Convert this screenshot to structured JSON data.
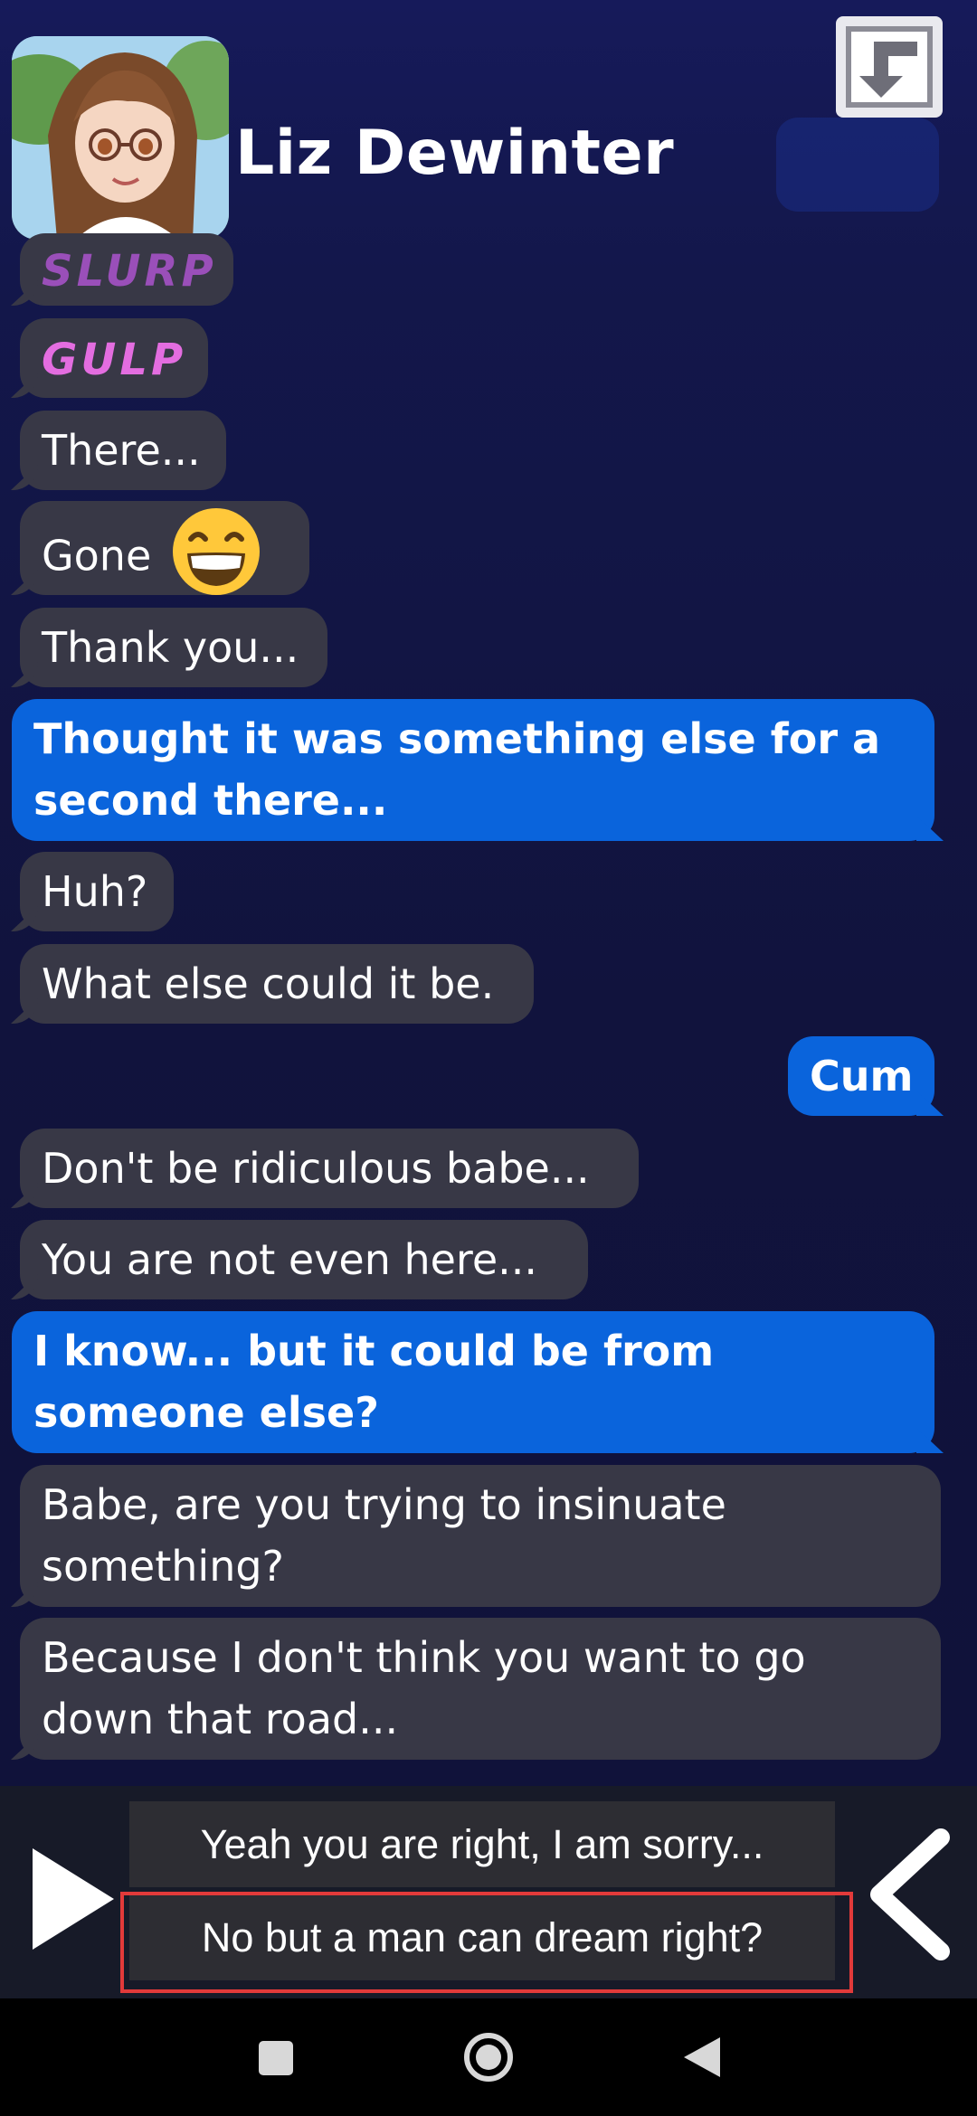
{
  "header": {
    "contact_name": "Liz Dewinter",
    "avatar_icon": "avatar-anime-girl-glasses",
    "download_icon": "download-arrow-icon"
  },
  "messages": [
    {
      "side": "in",
      "text": "SLURP",
      "style": "sfx"
    },
    {
      "side": "in",
      "text": "GULP",
      "style": "sfx"
    },
    {
      "side": "in",
      "text": "There..."
    },
    {
      "side": "in",
      "text": "Gone",
      "emoji": "grinning-face-emoji"
    },
    {
      "side": "in",
      "text": "Thank you..."
    },
    {
      "side": "out",
      "text": "Thought it was something else for a second there..."
    },
    {
      "side": "in",
      "text": "Huh?"
    },
    {
      "side": "in",
      "text": "What else could it be."
    },
    {
      "side": "out",
      "text": "Cum"
    },
    {
      "side": "in",
      "text": "Don't be ridiculous babe..."
    },
    {
      "side": "in",
      "text": "You are not even here..."
    },
    {
      "side": "out",
      "text": "I know... but it could be from someone else?"
    },
    {
      "side": "in",
      "text": "Babe, are you trying to insinuate something?"
    },
    {
      "side": "in",
      "text": "Because I don't think you want to go down that road..."
    }
  ],
  "choices": [
    {
      "label": "Yeah you are right, I am sorry...",
      "selected": false
    },
    {
      "label": "No but a man can dream right?",
      "selected": true
    }
  ],
  "controls": {
    "play_icon": "play-icon",
    "back_icon": "chevron-left-icon"
  },
  "navbar": {
    "recents_icon": "recents-square-icon",
    "home_icon": "home-circle-icon",
    "back_icon": "back-triangle-icon"
  },
  "colors": {
    "background": "#13163f",
    "incoming_bubble": "#383846",
    "outgoing_bubble": "#0a64dc",
    "slurp_text": "#9a4fb9",
    "gulp_text": "#e36de0",
    "choice_bg": "#2d2d33",
    "highlight": "#e23a3a"
  }
}
